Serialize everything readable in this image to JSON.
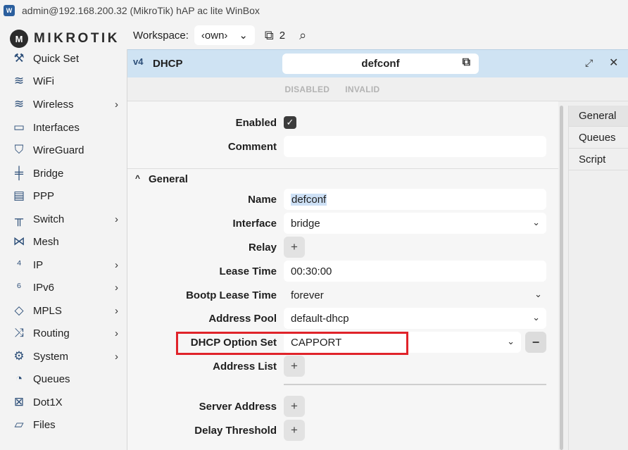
{
  "window": {
    "title": "admin@192.168.200.32 (MikroTik) hAP ac lite WinBox"
  },
  "brand": {
    "logo_text": "MIKROTIK",
    "logo_mark": "M"
  },
  "sidebar": {
    "items": [
      {
        "label": "Quick Set",
        "icon": "quick-set-icon",
        "glyph": "⚒",
        "submenu": false
      },
      {
        "label": "WiFi",
        "icon": "wifi-icon",
        "glyph": "≋",
        "submenu": false
      },
      {
        "label": "Wireless",
        "icon": "wireless-icon",
        "glyph": "≋",
        "submenu": true
      },
      {
        "label": "Interfaces",
        "icon": "interfaces-icon",
        "glyph": "▭",
        "submenu": false
      },
      {
        "label": "WireGuard",
        "icon": "wireguard-icon",
        "glyph": "⛉",
        "submenu": false
      },
      {
        "label": "Bridge",
        "icon": "bridge-icon",
        "glyph": "╪",
        "submenu": false
      },
      {
        "label": "PPP",
        "icon": "ppp-icon",
        "glyph": "▤",
        "submenu": false
      },
      {
        "label": "Switch",
        "icon": "switch-icon",
        "glyph": "╥",
        "submenu": true
      },
      {
        "label": "Mesh",
        "icon": "mesh-icon",
        "glyph": "⋈",
        "submenu": false
      },
      {
        "label": "IP",
        "icon": "ip-icon",
        "glyph": "⁴",
        "submenu": true
      },
      {
        "label": "IPv6",
        "icon": "ipv6-icon",
        "glyph": "⁶",
        "submenu": true
      },
      {
        "label": "MPLS",
        "icon": "mpls-icon",
        "glyph": "◇",
        "submenu": true
      },
      {
        "label": "Routing",
        "icon": "routing-icon",
        "glyph": "⤨",
        "submenu": true
      },
      {
        "label": "System",
        "icon": "system-icon",
        "glyph": "⚙",
        "submenu": true
      },
      {
        "label": "Queues",
        "icon": "queues-icon",
        "glyph": "◔",
        "submenu": false
      },
      {
        "label": "Dot1X",
        "icon": "dot1x-icon",
        "glyph": "⊠",
        "submenu": false
      },
      {
        "label": "Files",
        "icon": "files-icon",
        "glyph": "▱",
        "submenu": false
      }
    ],
    "submenu_arrow": "›"
  },
  "topbar": {
    "workspace_label": "Workspace:",
    "workspace_value": "‹own›",
    "workspace_caret": "⌄",
    "window_count": "2",
    "windows_glyph": "⧉",
    "zoom_glyph": "⌕"
  },
  "panel": {
    "icon_text": "v4",
    "title": "DHCP",
    "name": "defconf",
    "copy_glyph": "⧉",
    "expand_glyph": "⤢",
    "close_glyph": "✕",
    "flags": [
      "DISABLED",
      "INVALID"
    ]
  },
  "form": {
    "enabled_label": "Enabled",
    "enabled_checked": true,
    "check_glyph": "✓",
    "comment_label": "Comment",
    "comment_value": "",
    "section_label": "General",
    "section_chevron": "^",
    "name_label": "Name",
    "name_value": "defconf",
    "interface_label": "Interface",
    "interface_value": "bridge",
    "relay_label": "Relay",
    "lease_time_label": "Lease Time",
    "lease_time_value": "00:30:00",
    "bootp_label": "Bootp Lease Time",
    "bootp_value": "forever",
    "pool_label": "Address Pool",
    "pool_value": "default-dhcp",
    "option_set_label": "DHCP Option Set",
    "option_set_value": "CAPPORT",
    "address_list_label": "Address List",
    "server_address_label": "Server Address",
    "delay_threshold_label": "Delay Threshold",
    "plus_glyph": "+",
    "minus_glyph": "−",
    "caret_glyph": "⌄"
  },
  "tabs": [
    {
      "label": "General",
      "active": true
    },
    {
      "label": "Queues",
      "active": false
    },
    {
      "label": "Script",
      "active": false
    }
  ],
  "colors": {
    "header_bg": "#cfe3f3",
    "highlight": "#e0232a",
    "icon": "#2c4e78"
  }
}
